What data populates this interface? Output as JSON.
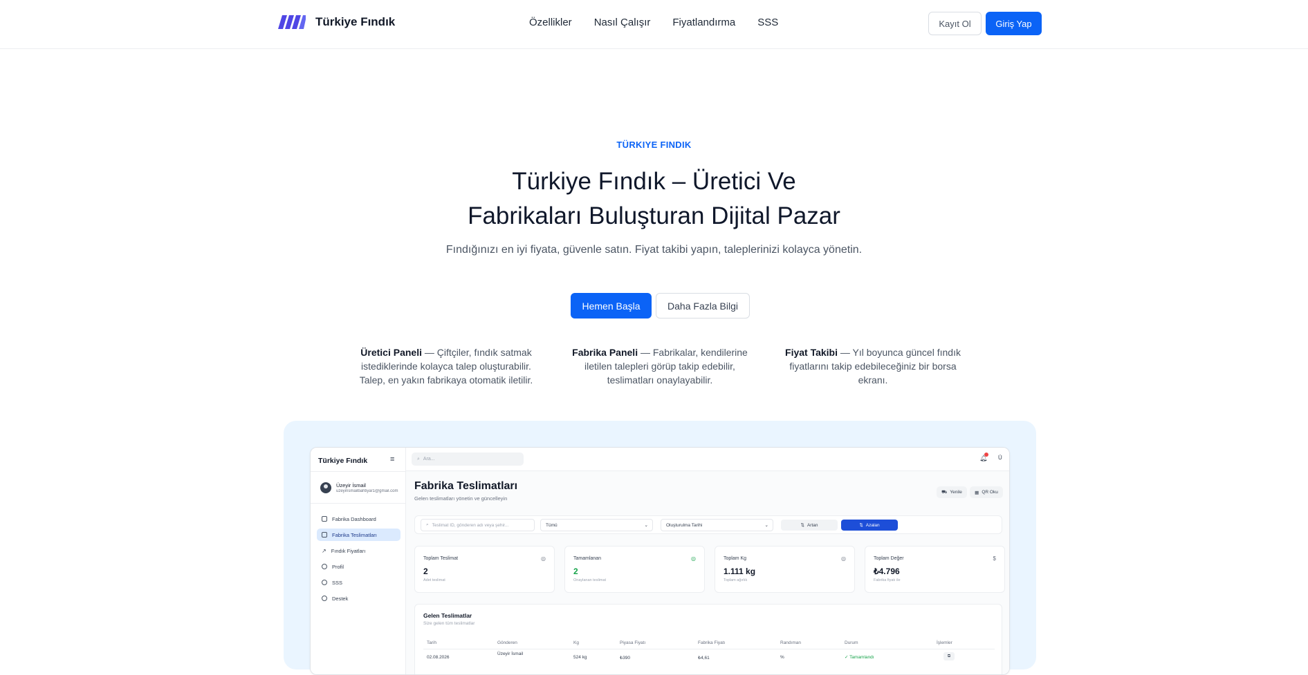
{
  "nav": {
    "brand": "Türkiye Fındık",
    "links": [
      "Özellikler",
      "Nasıl Çalışır",
      "Fiyatlandırma",
      "SSS"
    ],
    "register": "Kayıt Ol",
    "login": "Giriş Yap"
  },
  "colors": {
    "accent": "#0b63f6",
    "preview_bg": "#eaf5ff",
    "success": "#16a34a"
  },
  "hero": {
    "eyebrow": "TÜRKIYE FINDIK",
    "title_line1": "Türkiye Fındık – Üretici Ve",
    "title_line2": "Fabrikaları Buluşturan Dijital Pazar",
    "subtitle": "Fındığınızı en iyi fiyata, güvenle satın. Fiyat takibi yapın, taleplerinizi kolayca yönetin.",
    "cta_primary": "Hemen Başla",
    "cta_secondary": "Daha Fazla Bilgi"
  },
  "features": [
    {
      "title": "Üretici Paneli",
      "text": " — Çiftçiler, fındık satmak istediklerinde kolayca talep oluşturabilir. Talep, en yakın fabrikaya otomatik iletilir."
    },
    {
      "title": "Fabrika Paneli",
      "text": " — Fabrikalar, kendilerine iletilen talepleri görüp takip edebilir, teslimatları onaylayabilir."
    },
    {
      "title": "Fiyat Takibi",
      "text": " — Yıl boyunca güncel fındık fiyatlarını takip edebileceğiniz bir borsa ekranı."
    }
  ],
  "preview": {
    "sidebar": {
      "title": "Türkiye Fındık",
      "user_name": "Üzeyir İsmail",
      "user_email": "uzeyirismailbahtiyar1@gmail.com",
      "items": [
        "Fabrika Dashboard",
        "Fabrika Teslimatları",
        "Fındık Fiyatları",
        "Profil",
        "SSS",
        "Destek"
      ],
      "active_index": 1
    },
    "topbar": {
      "search_placeholder": "Ara...",
      "notification_count": "1",
      "user_initial": "Ü"
    },
    "page": {
      "title": "Fabrika Teslimatları",
      "subtitle": "Gelen teslimatları yönetin ve güncelleyin",
      "refresh": "Yenile",
      "qr": "QR Oku"
    },
    "filters": {
      "search_placeholder": "Teslimat ID, gönderen adı veya şehir...",
      "status": "Tümü",
      "sort_by": "Oluşturulma Tarihi",
      "asc": "Artan",
      "desc": "Azalan"
    },
    "stats": [
      {
        "label": "Toplam Teslimat",
        "value": "2",
        "note": "Adet teslimat",
        "icon": "◎"
      },
      {
        "label": "Tamamlanan",
        "value": "2",
        "note": "Onaylanan teslimat",
        "icon": "◎"
      },
      {
        "label": "Toplam Kg",
        "value": "1.111 kg",
        "note": "Toplam ağırlık",
        "icon": "◎"
      },
      {
        "label": "Toplam Değer",
        "value": "₺4.796",
        "note": "Fabrika fiyatı ile",
        "icon": "$"
      }
    ],
    "table": {
      "title": "Gelen Teslimatlar",
      "subtitle": "Size gelen tüm teslimatlar",
      "headers": [
        "Tarih",
        "Gönderen",
        "Kg",
        "Piyasa Fiyatı",
        "Fabrika Fiyatı",
        "Randıman",
        "Durum",
        "İşlemler"
      ],
      "row": [
        "02.08.2026",
        "Üzeyir İsmail",
        "524 kg",
        "₺390",
        "₺4,61",
        "%",
        "Tamamlandı",
        "⧉"
      ]
    }
  }
}
